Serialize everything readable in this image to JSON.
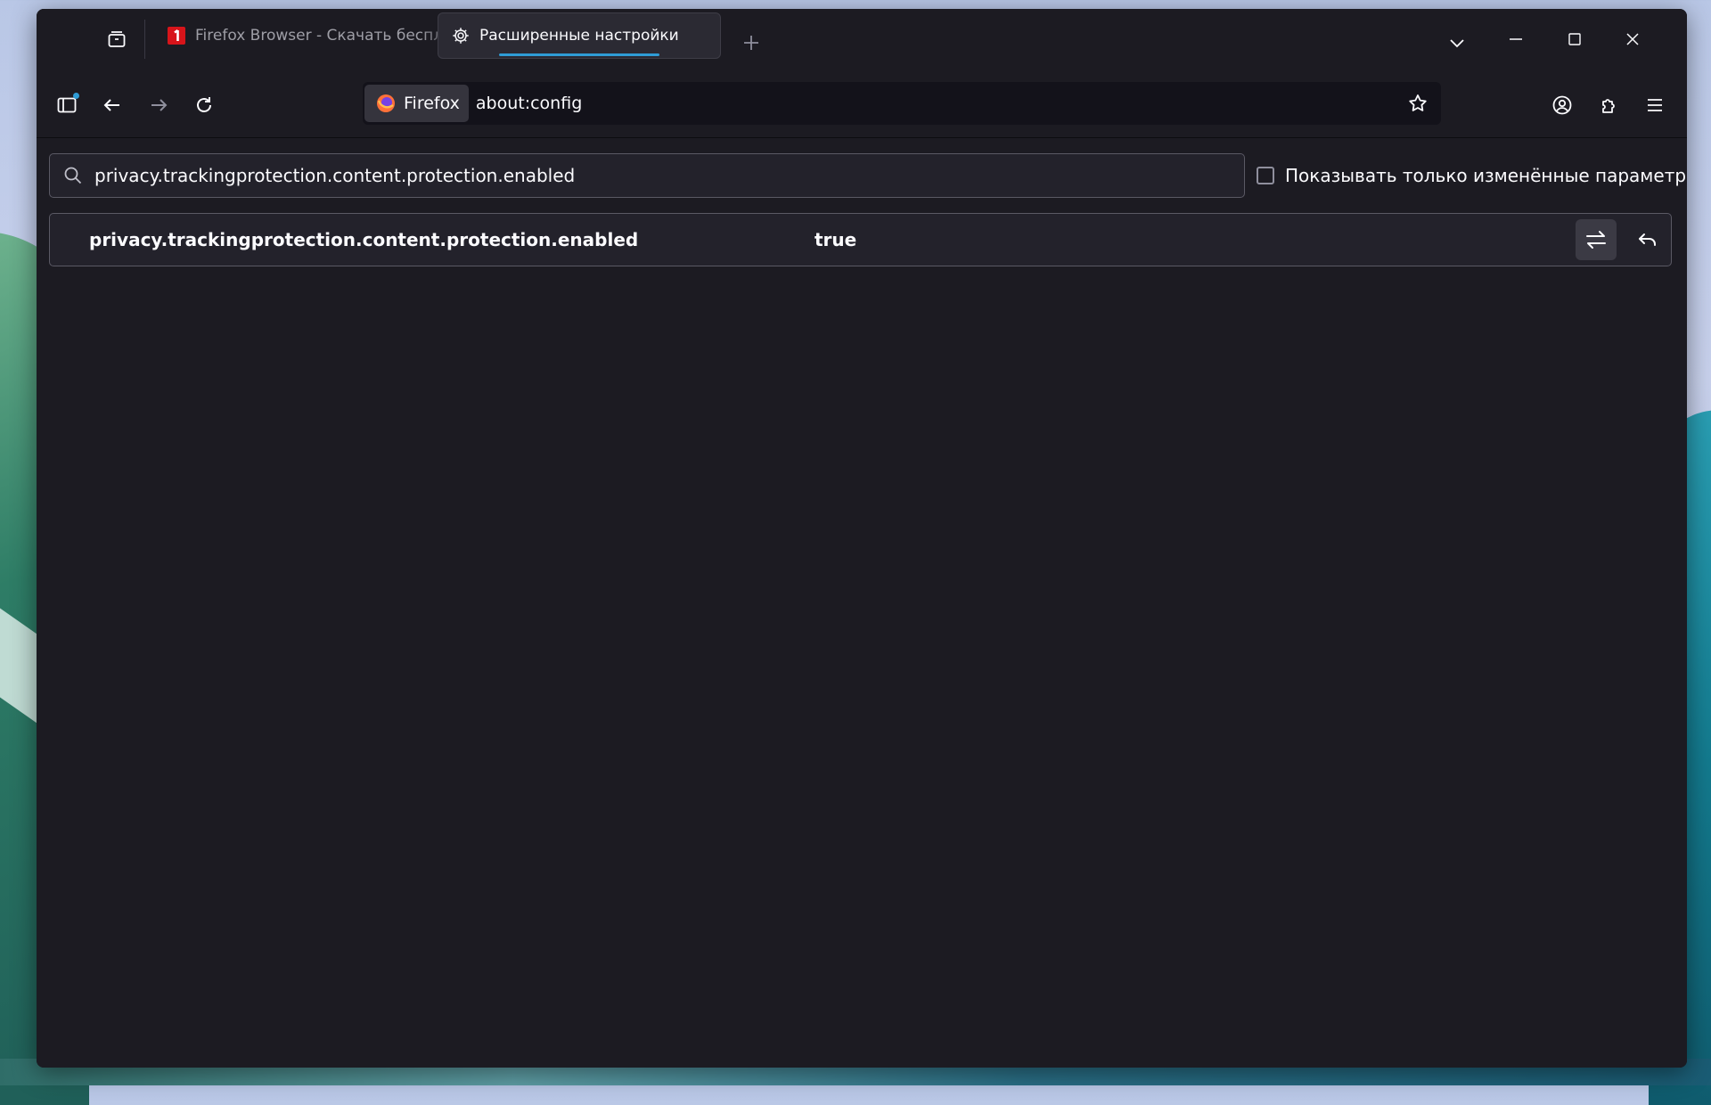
{
  "tabs": [
    {
      "title": "Firefox Browser - Скачать бесплатно",
      "active": false,
      "favicon": "red-logo-favicon"
    },
    {
      "title": "Расширенные настройки",
      "active": true,
      "favicon": "gear-icon"
    }
  ],
  "urlbar": {
    "identity_label": "Firefox",
    "url": "about:config"
  },
  "config": {
    "search_value": "privacy.trackingprotection.content.protection.enabled",
    "show_modified_label": "Показывать только изменённые параметры",
    "show_modified_checked": false,
    "rows": [
      {
        "name": "privacy.trackingprotection.content.protection.enabled",
        "value": "true"
      }
    ]
  },
  "colors": {
    "accent": "#2f9cd6",
    "background": "#1c1b22"
  }
}
